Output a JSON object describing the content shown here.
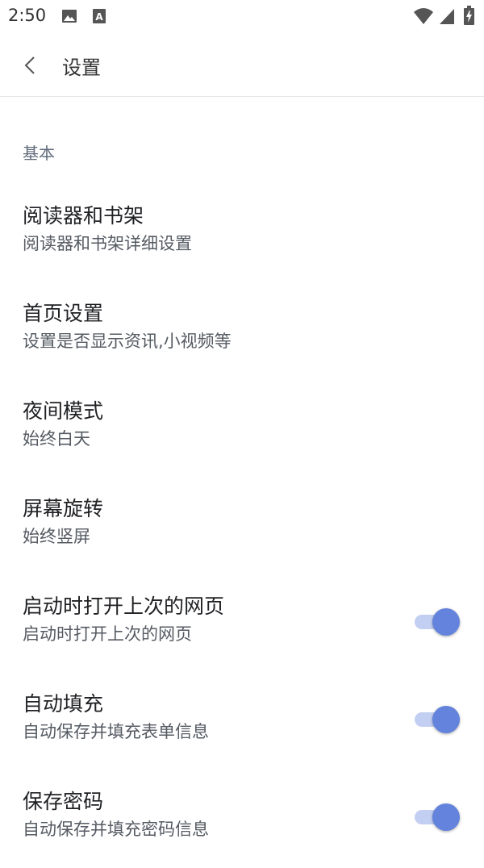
{
  "status_bar": {
    "time": "2:50",
    "icons": [
      "image-icon",
      "text-a-icon",
      "wifi-icon",
      "signal-icon",
      "battery-charging-icon"
    ]
  },
  "app_bar": {
    "title": "设置",
    "back_icon": "chevron-left-icon"
  },
  "section": {
    "title": "基本"
  },
  "settings": [
    {
      "title": "阅读器和书架",
      "subtitle": "阅读器和书架详细设置"
    },
    {
      "title": "首页设置",
      "subtitle": "设置是否显示资讯,小视频等"
    },
    {
      "title": "夜间模式",
      "subtitle": "始终白天"
    },
    {
      "title": "屏幕旋转",
      "subtitle": "始终竖屏"
    },
    {
      "title": "启动时打开上次的网页",
      "subtitle": "启动时打开上次的网页",
      "toggle_on": true
    },
    {
      "title": "自动填充",
      "subtitle": "自动保存并填充表单信息",
      "toggle_on": true
    },
    {
      "title": "保存密码",
      "subtitle": "自动保存并填充密码信息",
      "toggle_on": true
    }
  ],
  "colors": {
    "accent": "#6383dc",
    "accent_track": "#c3cff2",
    "section_header": "#5f6b7a"
  }
}
